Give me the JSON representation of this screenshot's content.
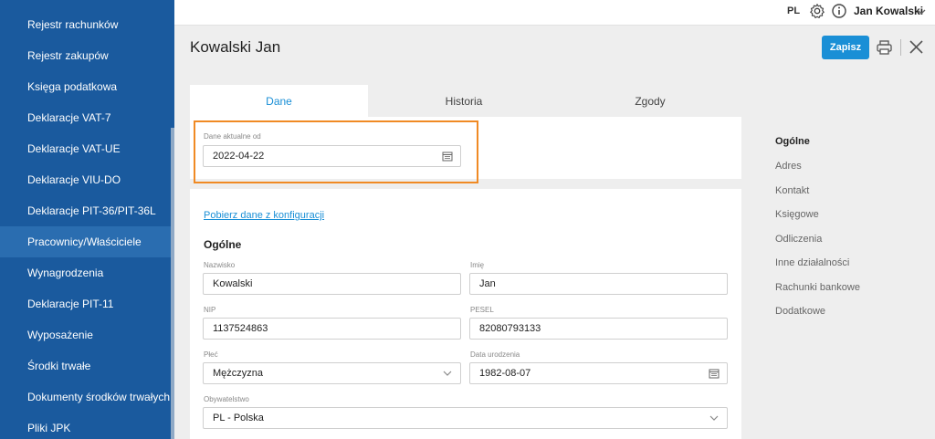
{
  "sidebar": {
    "items": [
      {
        "label": "Rejestr rachunków"
      },
      {
        "label": "Rejestr zakupów"
      },
      {
        "label": "Księga podatkowa"
      },
      {
        "label": "Deklaracje VAT-7"
      },
      {
        "label": "Deklaracje VAT-UE"
      },
      {
        "label": "Deklaracje VIU-DO"
      },
      {
        "label": "Deklaracje PIT-36/PIT-36L"
      },
      {
        "label": "Pracownicy/Właściciele"
      },
      {
        "label": "Wynagrodzenia"
      },
      {
        "label": "Deklaracje PIT-11"
      },
      {
        "label": "Wyposażenie"
      },
      {
        "label": "Środki trwałe"
      },
      {
        "label": "Dokumenty środków trwałych"
      },
      {
        "label": "Pliki JPK"
      }
    ]
  },
  "topbar": {
    "lang": "PL",
    "user": "Jan Kowalski"
  },
  "page": {
    "title": "Kowalski Jan",
    "save_label": "Zapisz"
  },
  "tabs": [
    {
      "label": "Dane"
    },
    {
      "label": "Historia"
    },
    {
      "label": "Zgody"
    }
  ],
  "valid_from": {
    "label": "Dane aktualne od",
    "value": "2022-04-22"
  },
  "form": {
    "fetch_link": "Pobierz dane z konfiguracji",
    "section_title": "Ogólne",
    "surname": {
      "label": "Nazwisko",
      "value": "Kowalski"
    },
    "first_name": {
      "label": "Imię",
      "value": "Jan"
    },
    "nip": {
      "label": "NIP",
      "value": "1137524863"
    },
    "pesel": {
      "label": "PESEL",
      "value": "82080793133"
    },
    "gender": {
      "label": "Płeć",
      "value": "Mężczyzna"
    },
    "birth_date": {
      "label": "Data urodzenia",
      "value": "1982-08-07"
    },
    "citizenship": {
      "label": "Obywatelstwo",
      "value": "PL - Polska"
    }
  },
  "right_nav": {
    "items": [
      {
        "label": "Ogólne"
      },
      {
        "label": "Adres"
      },
      {
        "label": "Kontakt"
      },
      {
        "label": "Księgowe"
      },
      {
        "label": "Odliczenia"
      },
      {
        "label": "Inne działalności"
      },
      {
        "label": "Rachunki bankowe"
      },
      {
        "label": "Dodatkowe"
      }
    ]
  },
  "colors": {
    "sidebar": "#1a5a9e",
    "accent": "#1a8fd6",
    "highlight": "#f08a24"
  }
}
